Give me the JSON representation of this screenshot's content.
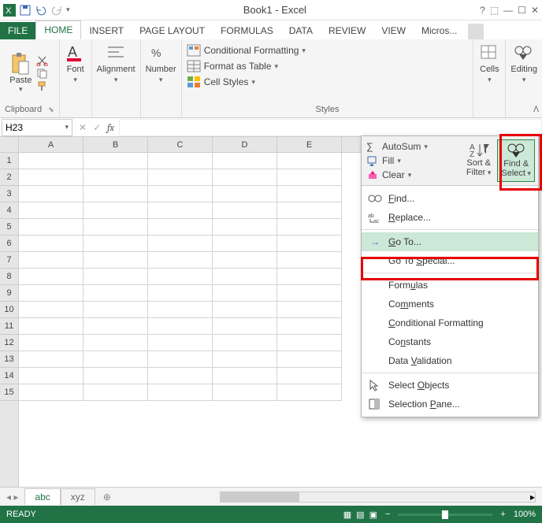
{
  "titlebar": {
    "title": "Book1 - Excel",
    "help": "?",
    "min": "—",
    "max": "☐",
    "close": "✕"
  },
  "tabs": {
    "file": "FILE",
    "home": "HOME",
    "insert": "INSERT",
    "pagelayout": "PAGE LAYOUT",
    "formulas": "FORMULAS",
    "data": "DATA",
    "review": "REVIEW",
    "view": "VIEW",
    "account": "Micros..."
  },
  "ribbon": {
    "clipboard": {
      "label": "Clipboard",
      "paste": "Paste"
    },
    "font": {
      "label": "Font"
    },
    "alignment": {
      "label": "Alignment"
    },
    "number": {
      "label": "Number"
    },
    "styles": {
      "label": "Styles",
      "conditional": "Conditional Formatting",
      "table": "Format as Table",
      "cell": "Cell Styles"
    },
    "cells": {
      "label": "Cells"
    },
    "editing": {
      "label": "Editing"
    }
  },
  "namebox": "H23",
  "columns": [
    "A",
    "B",
    "C",
    "D",
    "E"
  ],
  "rows": [
    "1",
    "2",
    "3",
    "4",
    "5",
    "6",
    "7",
    "8",
    "9",
    "10",
    "11",
    "12",
    "13",
    "14",
    "15"
  ],
  "sheets": {
    "s1": "abc",
    "s2": "xyz"
  },
  "statusbar": {
    "ready": "READY",
    "zoom": "100%"
  },
  "dropdown": {
    "autosum": "AutoSum",
    "fill": "Fill",
    "clear": "Clear",
    "sort": "Sort &",
    "filter": "Filter",
    "find": "Find &",
    "select": "Select",
    "items": {
      "find_cmd": "Find...",
      "replace": "Replace...",
      "goto": "Go To...",
      "special": "Go To Special...",
      "formulas": "Formulas",
      "comments": "Comments",
      "condfmt": "Conditional Formatting",
      "constants": "Constants",
      "validation": "Data Validation",
      "selobj": "Select Objects",
      "selpane": "Selection Pane..."
    }
  }
}
